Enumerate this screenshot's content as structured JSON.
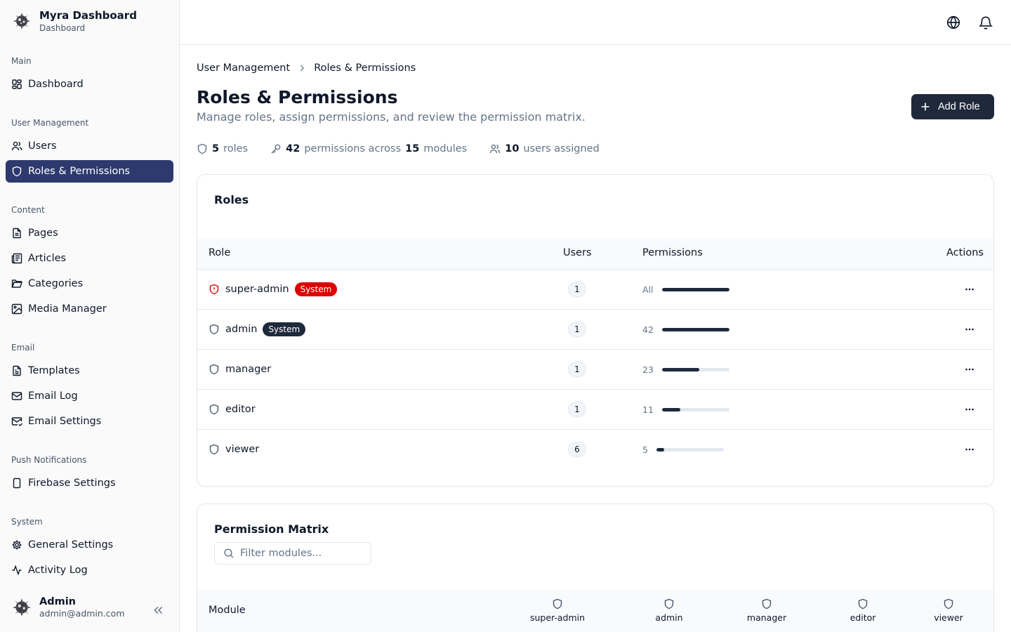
{
  "app": {
    "title": "Myra Dashboard",
    "subtitle": "Dashboard"
  },
  "sidebar": {
    "groups": [
      {
        "label": "Main",
        "items": [
          {
            "label": "Dashboard",
            "icon": "layout-grid-icon"
          }
        ]
      },
      {
        "label": "User Management",
        "items": [
          {
            "label": "Users",
            "icon": "users-icon"
          },
          {
            "label": "Roles & Permissions",
            "icon": "shield-icon",
            "active": true
          }
        ]
      },
      {
        "label": "Content",
        "items": [
          {
            "label": "Pages",
            "icon": "file-icon"
          },
          {
            "label": "Articles",
            "icon": "newspaper-icon"
          },
          {
            "label": "Categories",
            "icon": "folder-icon"
          },
          {
            "label": "Media Manager",
            "icon": "image-icon"
          }
        ]
      },
      {
        "label": "Email",
        "items": [
          {
            "label": "Templates",
            "icon": "file-text-icon"
          },
          {
            "label": "Email Log",
            "icon": "mail-icon"
          },
          {
            "label": "Email Settings",
            "icon": "mail-settings-icon"
          }
        ]
      },
      {
        "label": "Push Notifications",
        "items": [
          {
            "label": "Firebase Settings",
            "icon": "smartphone-icon"
          }
        ]
      },
      {
        "label": "System",
        "items": [
          {
            "label": "General Settings",
            "icon": "gear-icon"
          },
          {
            "label": "Activity Log",
            "icon": "activity-icon"
          }
        ]
      }
    ],
    "user": {
      "name": "Admin",
      "email": "admin@admin.com"
    }
  },
  "breadcrumb": [
    "User Management",
    "Roles & Permissions"
  ],
  "page": {
    "title": "Roles & Permissions",
    "subtitle": "Manage roles, assign permissions, and review the permission matrix.",
    "add_button": "Add Role"
  },
  "stats": {
    "roles_count": "5",
    "roles_label": "roles",
    "permissions_count": "42",
    "permissions_label": "permissions across",
    "modules_count": "15",
    "modules_label": "modules",
    "users_count": "10",
    "users_label": "users assigned"
  },
  "roles_card": {
    "title": "Roles",
    "columns": {
      "role": "Role",
      "users": "Users",
      "permissions": "Permissions",
      "actions": "Actions"
    },
    "rows": [
      {
        "name": "super-admin",
        "badge": "System",
        "badge_color": "#dc0000",
        "users": "1",
        "perm_label": "All",
        "perm_fraction": 1.0,
        "icon_color": "#dc0000"
      },
      {
        "name": "admin",
        "badge": "System",
        "badge_color": "#1e293b",
        "users": "1",
        "perm_label": "42",
        "perm_fraction": 1.0,
        "icon_color": "#475569"
      },
      {
        "name": "manager",
        "badge": "",
        "users": "1",
        "perm_label": "23",
        "perm_fraction": 0.55,
        "icon_color": "#475569"
      },
      {
        "name": "editor",
        "badge": "",
        "users": "1",
        "perm_label": "11",
        "perm_fraction": 0.27,
        "icon_color": "#475569"
      },
      {
        "name": "viewer",
        "badge": "",
        "users": "6",
        "perm_label": "5",
        "perm_fraction": 0.12,
        "icon_color": "#475569"
      }
    ]
  },
  "matrix_card": {
    "title": "Permission Matrix",
    "filter_placeholder": "Filter modules...",
    "module_header": "Module",
    "role_columns": [
      "super-admin",
      "admin",
      "manager",
      "editor",
      "viewer"
    ]
  },
  "colors": {
    "accent": "#2e3a6e",
    "primary": "#1e293b",
    "danger": "#dc0000"
  }
}
